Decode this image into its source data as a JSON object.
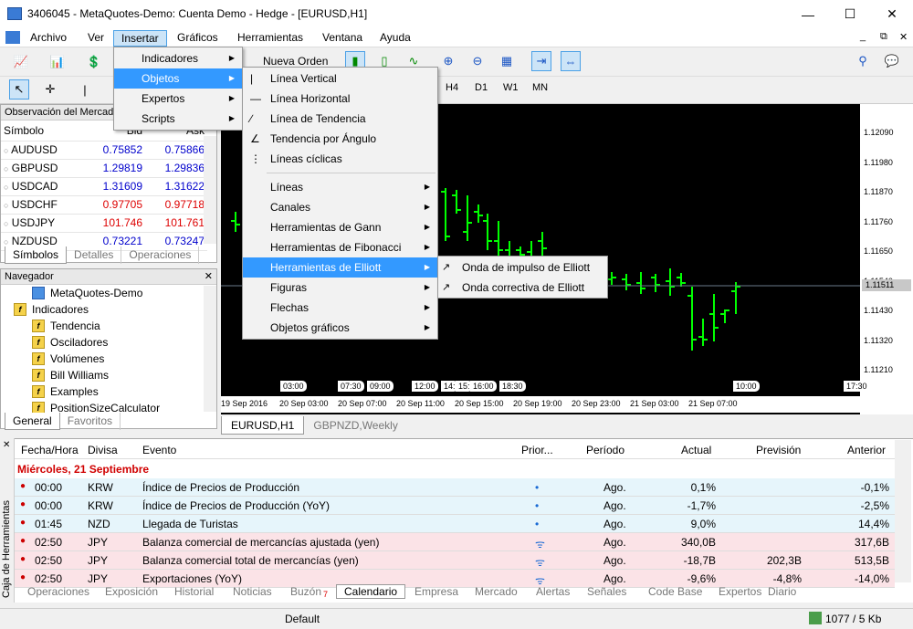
{
  "window": {
    "title": "3406045 - MetaQuotes-Demo: Cuenta Demo - Hedge - [EURUSD,H1]"
  },
  "menu": [
    "Archivo",
    "Ver",
    "Insertar",
    "Gráficos",
    "Herramientas",
    "Ventana",
    "Ayuda"
  ],
  "toolbar": {
    "new_order": "Nueva Orden",
    "timeframes": [
      "H4",
      "D1",
      "W1",
      "MN"
    ]
  },
  "market_watch": {
    "title": "Observación del Mercado",
    "headers": [
      "Símbolo",
      "Bid",
      "Ask"
    ],
    "rows": [
      {
        "symbol": "AUDUSD",
        "bid": "0.75852",
        "ask": "0.75866",
        "color": "#0000cc"
      },
      {
        "symbol": "GBPUSD",
        "bid": "1.29819",
        "ask": "1.29836",
        "color": "#0000cc"
      },
      {
        "symbol": "USDCAD",
        "bid": "1.31609",
        "ask": "1.31622",
        "color": "#0000cc"
      },
      {
        "symbol": "USDCHF",
        "bid": "0.97705",
        "ask": "0.97718",
        "color": "#dd0000"
      },
      {
        "symbol": "USDJPY",
        "bid": "101.746",
        "ask": "101.761",
        "color": "#dd0000"
      },
      {
        "symbol": "NZDUSD",
        "bid": "0.73221",
        "ask": "0.73247",
        "color": "#0000cc"
      }
    ],
    "tabs": [
      "Símbolos",
      "Detalles",
      "Operaciones"
    ]
  },
  "navigator": {
    "title": "Navegador",
    "items": [
      "MetaQuotes-Demo",
      "Indicadores",
      "Tendencia",
      "Osciladores",
      "Volúmenes",
      "Bill Williams",
      "Examples",
      "PositionSizeCalculator"
    ],
    "tabs": [
      "General",
      "Favoritos"
    ]
  },
  "chart": {
    "prices": [
      "1.12090",
      "1.11980",
      "1.11870",
      "1.11760",
      "1.11650",
      "1.11540",
      "1.11430",
      "1.11320",
      "1.11210"
    ],
    "current_price": "1.11511",
    "time_labels": [
      "19 Sep 2016",
      "20 Sep 03:00",
      "20 Sep 07:00",
      "20 Sep 11:00",
      "20 Sep 15:00",
      "20 Sep 19:00",
      "20 Sep 23:00",
      "21 Sep 03:00",
      "21 Sep 07:00"
    ],
    "time_tags": [
      "03:00",
      "07:30",
      "09:00",
      "12:00",
      "14:",
      "15:",
      "16:00",
      "18:30",
      "10:00",
      "17:30"
    ],
    "tabs": [
      "EURUSD,H1",
      "GBPNZD,Weekly"
    ]
  },
  "insert_menu": [
    "Indicadores",
    "Objetos",
    "Expertos",
    "Scripts"
  ],
  "objects_menu": [
    "Línea Vertical",
    "Línea Horizontal",
    "Línea de Tendencia",
    "Tendencia por Ángulo",
    "Líneas cíclicas",
    "Líneas",
    "Canales",
    "Herramientas de Gann",
    "Herramientas de Fibonacci",
    "Herramientas de Elliott",
    "Figuras",
    "Flechas",
    "Objetos gráficos"
  ],
  "elliott_menu": [
    "Onda de impulso de Elliott",
    "Onda correctiva de Elliott"
  ],
  "calendar": {
    "headers": [
      "Fecha/Hora",
      "Divisa",
      "Evento",
      "Prior...",
      "Período",
      "Actual",
      "Previsión",
      "Anterior"
    ],
    "day": "Miércoles, 21 Septiembre",
    "rows": [
      {
        "time": "00:00",
        "cur": "KRW",
        "event": "Índice de Precios de Producción",
        "prio": "•",
        "period": "Ago.",
        "actual": "0,1%",
        "forecast": "",
        "prev": "-0,1%"
      },
      {
        "time": "00:00",
        "cur": "KRW",
        "event": "Índice de Precios de Producción (YoY)",
        "prio": "•",
        "period": "Ago.",
        "actual": "-1,7%",
        "forecast": "",
        "prev": "-2,5%"
      },
      {
        "time": "01:45",
        "cur": "NZD",
        "event": "Llegada de Turistas",
        "prio": "•",
        "period": "Ago.",
        "actual": "9,0%",
        "forecast": "",
        "prev": "14,4%"
      },
      {
        "time": "02:50",
        "cur": "JPY",
        "event": "Balanza comercial de mercancías ajustada (yen)",
        "prio": "ᯤ",
        "period": "Ago.",
        "actual": "340,0B",
        "forecast": "",
        "prev": "317,6B"
      },
      {
        "time": "02:50",
        "cur": "JPY",
        "event": "Balanza comercial total de mercancías (yen)",
        "prio": "ᯤ",
        "period": "Ago.",
        "actual": "-18,7B",
        "forecast": "202,3B",
        "prev": "513,5B"
      },
      {
        "time": "02:50",
        "cur": "JPY",
        "event": "Exportaciones (YoY)",
        "prio": "ᯤ",
        "period": "Ago.",
        "actual": "-9,6%",
        "forecast": "-4,8%",
        "prev": "-14,0%"
      }
    ]
  },
  "toolbox": {
    "side_label": "Caja de Herramientas",
    "tabs": [
      "Operaciones",
      "Exposición",
      "Historial",
      "Noticias",
      "Buzón",
      "Calendario",
      "Empresa",
      "Mercado",
      "Alertas",
      "Señales",
      "Code Base",
      "Expertos",
      "Diario"
    ],
    "badge": "7"
  },
  "status": {
    "profile": "Default",
    "traffic": "1077 / 5 Kb"
  }
}
